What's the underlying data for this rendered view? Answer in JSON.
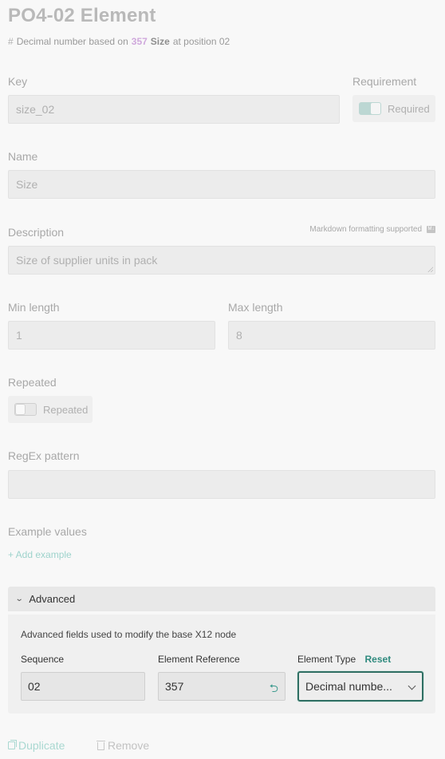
{
  "header": {
    "title": "PO4-02 Element",
    "subtitle_prefix": "Decimal number based on",
    "subtitle_ref": "357",
    "subtitle_name": "Size",
    "subtitle_suffix": "at position 02"
  },
  "key": {
    "label": "Key",
    "value": "size_02"
  },
  "requirement": {
    "label": "Requirement",
    "toggle_label": "Required",
    "on": true
  },
  "name": {
    "label": "Name",
    "value": "Size"
  },
  "description": {
    "label": "Description",
    "markdown_note": "Markdown formatting supported",
    "markdown_icon": "markdown-icon",
    "value": "Size of supplier units in pack"
  },
  "min_length": {
    "label": "Min length",
    "value": "1"
  },
  "max_length": {
    "label": "Max length",
    "value": "8"
  },
  "repeated": {
    "label": "Repeated",
    "toggle_label": "Repeated",
    "on": false
  },
  "regex": {
    "label": "RegEx pattern",
    "value": ""
  },
  "examples": {
    "label": "Example values",
    "add_label": "+ Add example"
  },
  "advanced": {
    "header": "Advanced",
    "description": "Advanced fields used to modify the base X12 node",
    "sequence": {
      "label": "Sequence",
      "value": "02"
    },
    "element_reference": {
      "label": "Element Reference",
      "value": "357"
    },
    "element_type": {
      "label": "Element Type",
      "reset_label": "Reset",
      "value": "Decimal numbe..."
    }
  },
  "footer": {
    "duplicate_label": "Duplicate",
    "remove_label": "Remove"
  },
  "colors": {
    "accent": "#2f8a7e",
    "ref_highlight": "#cfa8dc"
  }
}
